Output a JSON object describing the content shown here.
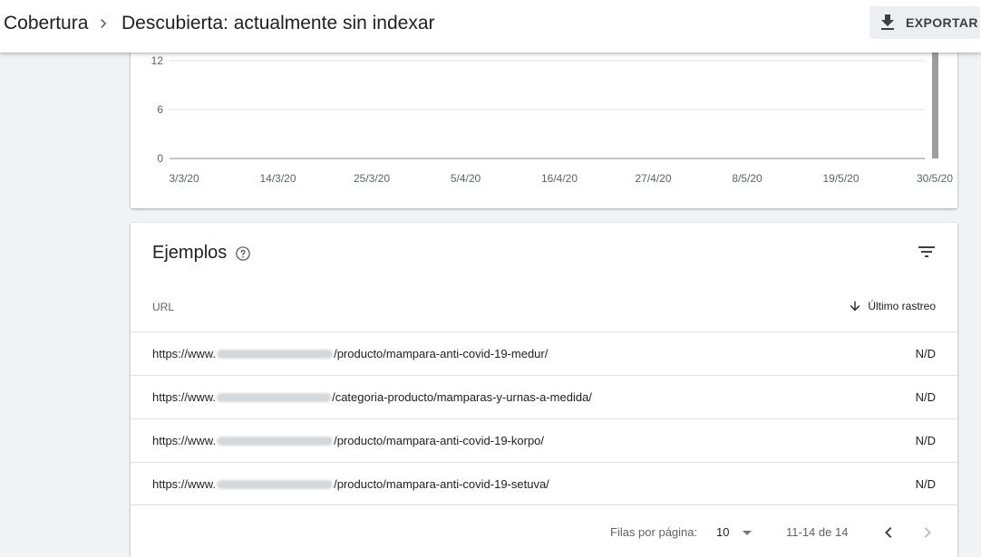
{
  "header": {
    "breadcrumb_root": "Cobertura",
    "breadcrumb_current": "Descubierta: actualmente sin indexar",
    "export_label": "EXPORTAR"
  },
  "chart_data": {
    "type": "bar",
    "y_ticks": [
      "12",
      "6",
      "0"
    ],
    "x_ticks": [
      "3/3/20",
      "14/3/20",
      "25/3/20",
      "5/4/20",
      "16/4/20",
      "27/4/20",
      "8/5/20",
      "19/5/20",
      "30/5/20"
    ],
    "ylim": [
      0,
      12
    ],
    "grid": true,
    "series": [
      {
        "date": "30/5/20",
        "value": 14,
        "color": "#9e9e9e"
      }
    ]
  },
  "examples": {
    "title": "Ejemplos",
    "col_url": "URL",
    "col_last": "Último rastreo",
    "rows": [
      {
        "prefix": "https://www.",
        "path": "/producto/mampara-anti-covid-19-medur/",
        "last": "N/D"
      },
      {
        "prefix": "https://www.",
        "path": "/categoria-producto/mamparas-y-urnas-a-medida/",
        "last": "N/D"
      },
      {
        "prefix": "https://www.",
        "path": "/producto/mampara-anti-covid-19-korpo/",
        "last": "N/D"
      },
      {
        "prefix": "https://www.",
        "path": "/producto/mampara-anti-covid-19-setuva/",
        "last": "N/D"
      }
    ]
  },
  "pagination": {
    "rows_label": "Filas por página:",
    "rows_value": "10",
    "range": "11-14 de 14"
  },
  "colors": {
    "grid": "#e0e0e0",
    "axis": "#5f6368",
    "bar": "#9e9e9e"
  }
}
